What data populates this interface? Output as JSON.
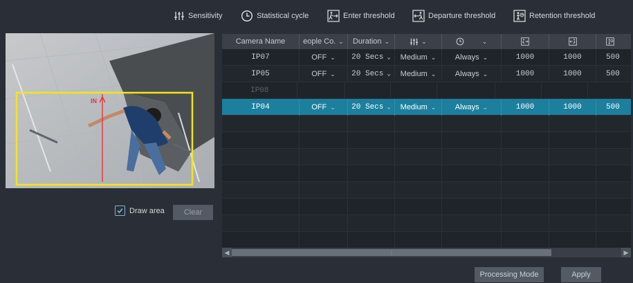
{
  "legend": {
    "sensitivity": "Sensitivity",
    "statistical_cycle": "Statistical cycle",
    "enter_threshold": "Enter threshold",
    "departure_threshold": "Departure threshold",
    "retention_threshold": "Retention threshold"
  },
  "preview": {
    "line_label": "IN"
  },
  "draw_area": {
    "label": "Draw area",
    "checked": true
  },
  "clear_label": "Clear",
  "table": {
    "headers": {
      "camera_name": "Camera Name",
      "people_count": "eople Co.",
      "duration": "Duration"
    },
    "rows": [
      {
        "camera": "IP07",
        "people_count": "OFF",
        "duration": "20 Secs",
        "sensitivity": "Medium",
        "cycle": "Always",
        "enter": "1000",
        "departure": "1000",
        "retention": "500",
        "state": "normal"
      },
      {
        "camera": "IP05",
        "people_count": "OFF",
        "duration": "20 Secs",
        "sensitivity": "Medium",
        "cycle": "Always",
        "enter": "1000",
        "departure": "1000",
        "retention": "500",
        "state": "normal"
      },
      {
        "camera": "IP08",
        "people_count": "",
        "duration": "",
        "sensitivity": "",
        "cycle": "",
        "enter": "",
        "departure": "",
        "retention": "",
        "state": "disabled"
      },
      {
        "camera": "IP04",
        "people_count": "OFF",
        "duration": "20 Secs",
        "sensitivity": "Medium",
        "cycle": "Always",
        "enter": "1000",
        "departure": "1000",
        "retention": "500",
        "state": "selected"
      }
    ]
  },
  "footer": {
    "processing_mode": "Processing Mode",
    "apply": "Apply"
  },
  "colors": {
    "accent": "#1d7f9e",
    "detection_box": "#f4e51c",
    "line": "#e8323a"
  }
}
